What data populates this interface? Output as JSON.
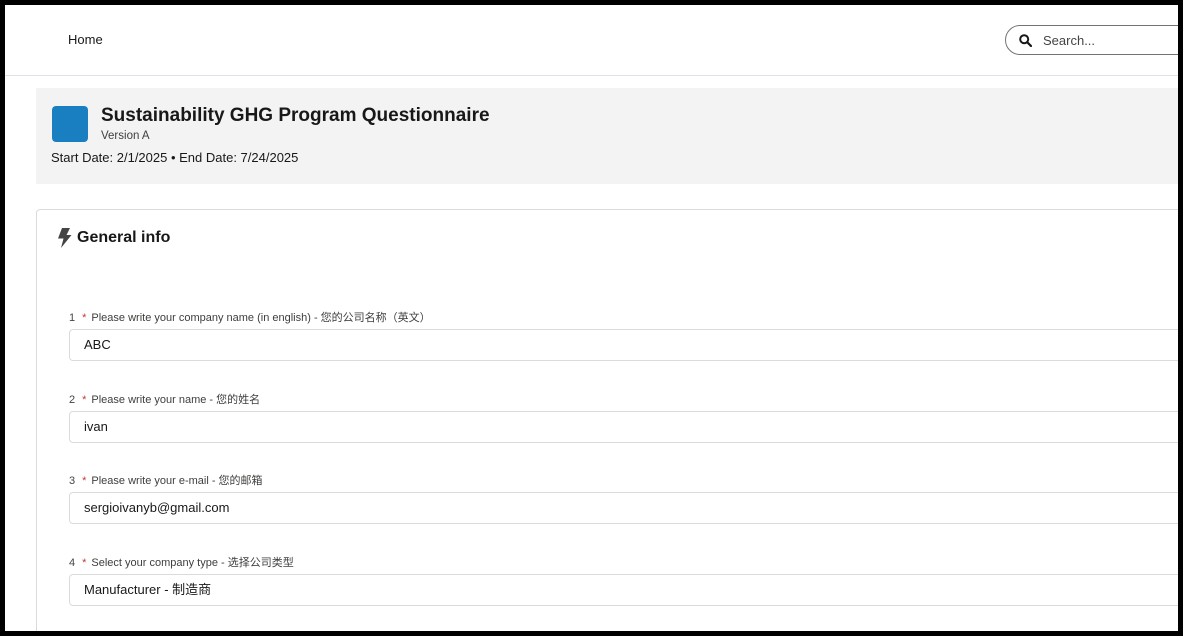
{
  "nav": {
    "home_label": "Home"
  },
  "search": {
    "placeholder": "Search..."
  },
  "header": {
    "title": "Sustainability GHG Program Questionnaire",
    "version": "Version A",
    "dates": "Start Date: 2/1/2025 • End Date: 7/24/2025",
    "icon_color": "#1a7fc1"
  },
  "section": {
    "title": "General info",
    "icon": "bolt-icon"
  },
  "questions": [
    {
      "number": "1",
      "required": "*",
      "label": "Please write your company name (in english) - 您的公司名称（英文）",
      "value": "ABC"
    },
    {
      "number": "2",
      "required": "*",
      "label": "Please write your name - 您的姓名",
      "value": "ivan"
    },
    {
      "number": "3",
      "required": "*",
      "label": "Please write your e-mail - 您的邮箱",
      "value": "sergioivanyb@gmail.com"
    },
    {
      "number": "4",
      "required": "*",
      "label": "Select your company type - 选择公司类型",
      "value": "Manufacturer - 制造商"
    }
  ]
}
